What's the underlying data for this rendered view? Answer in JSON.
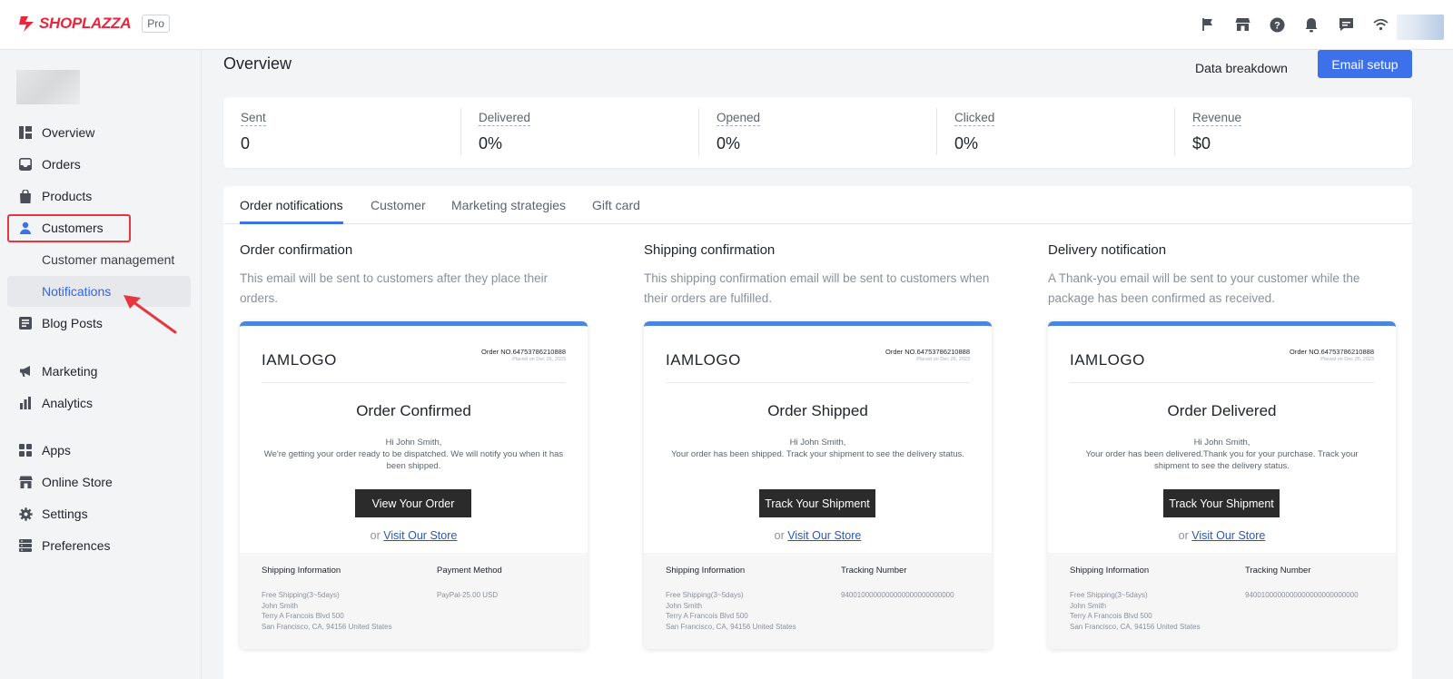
{
  "brand": {
    "name": "SHOPLAZZA",
    "badge": "Pro"
  },
  "topbar_icons": [
    "flag-icon",
    "store-icon",
    "help-icon",
    "bell-icon",
    "chat-icon",
    "wifi-icon"
  ],
  "sidebar": {
    "items": [
      {
        "label": "Overview",
        "icon": "dashboard-icon"
      },
      {
        "label": "Orders",
        "icon": "inbox-icon"
      },
      {
        "label": "Products",
        "icon": "bag-icon"
      },
      {
        "label": "Customers",
        "icon": "person-icon"
      },
      {
        "label": "Customer management"
      },
      {
        "label": "Notifications"
      },
      {
        "label": "Blog Posts",
        "icon": "blog-icon"
      },
      {
        "label": "Marketing",
        "icon": "megaphone-icon"
      },
      {
        "label": "Analytics",
        "icon": "bar-chart-icon"
      },
      {
        "label": "Apps",
        "icon": "apps-icon"
      },
      {
        "label": "Online Store",
        "icon": "store-icon"
      },
      {
        "label": "Settings",
        "icon": "gear-icon"
      },
      {
        "label": "Preferences",
        "icon": "preferences-icon"
      }
    ]
  },
  "header": {
    "title": "Overview",
    "data_breakdown": "Data breakdown",
    "email_setup": "Email setup"
  },
  "stats": [
    {
      "label": "Sent",
      "value": "0"
    },
    {
      "label": "Delivered",
      "value": "0%"
    },
    {
      "label": "Opened",
      "value": "0%"
    },
    {
      "label": "Clicked",
      "value": "0%"
    },
    {
      "label": "Revenue",
      "value": "$0"
    }
  ],
  "tabs": [
    "Order notifications",
    "Customer",
    "Marketing strategies",
    "Gift card"
  ],
  "columns": [
    {
      "title": "Order confirmation",
      "desc": "This email will be sent to customers after they place their orders.",
      "preview": {
        "logo": "IAMLOGO",
        "order_no": "Order NO.647537862108​88",
        "placed": "Placed on Dec 26, 2023",
        "heading": "Order Confirmed",
        "greeting": "Hi  John Smith,",
        "body": "We're getting your order ready to be dispatched. We will notify you when it has been shipped.",
        "button": "View Your Order",
        "or": "or",
        "link": "Visit Our Store",
        "left_h": "Shipping Information",
        "left_lines": [
          "Free Shipping(3~5days)",
          "John Smith",
          "Terry A Francois Blvd 500",
          "San Francisco,  CA,  94156 United States"
        ],
        "right_h": "Payment Method",
        "right_lines": [
          "PayPal-25.00 USD"
        ]
      }
    },
    {
      "title": "Shipping confirmation",
      "desc": "This shipping confirmation email will be sent to customers when their orders are fulfilled.",
      "preview": {
        "logo": "IAMLOGO",
        "order_no": "Order NO.647537862108​88",
        "placed": "Placed on Dec 26, 2023",
        "heading": "Order Shipped",
        "greeting": "Hi  John Smith,",
        "body": "Your order has been shipped. Track your shipment to see the delivery status.",
        "button": "Track Your Shipment",
        "or": "or",
        "link": "Visit Our Store",
        "left_h": "Shipping Information",
        "left_lines": [
          "Free Shipping(3~5days)",
          "John Smith",
          "Terry A Francois Blvd 500",
          "San Francisco,  CA,  94156 United States"
        ],
        "right_h": "Tracking Number",
        "right_lines": [
          "9400100000000000000000000000"
        ]
      }
    },
    {
      "title": "Delivery notification",
      "desc": "A Thank-you email will be sent to your customer while the package has been confirmed as received.",
      "preview": {
        "logo": "IAMLOGO",
        "order_no": "Order NO.647537862108​88",
        "placed": "Placed on Dec 26, 2023",
        "heading": "Order Delivered",
        "greeting": "Hi  John Smith,",
        "body": "Your order has been delivered.Thank you for your purchase. Track your shipment to see the delivery status.",
        "button": "Track Your Shipment",
        "or": "or",
        "link": "Visit Our Store",
        "left_h": "Shipping Information",
        "left_lines": [
          "Free Shipping(3~5days)",
          "John Smith",
          "Terry A Francois Blvd 500",
          "San Francisco,  CA,  94156 United States"
        ],
        "right_h": "Tracking Number",
        "right_lines": [
          "9400100000000000000000000000"
        ]
      }
    }
  ],
  "colors": {
    "accent": "#3d70eb",
    "brand": "#e8263c",
    "highlight": "#e6373f"
  }
}
